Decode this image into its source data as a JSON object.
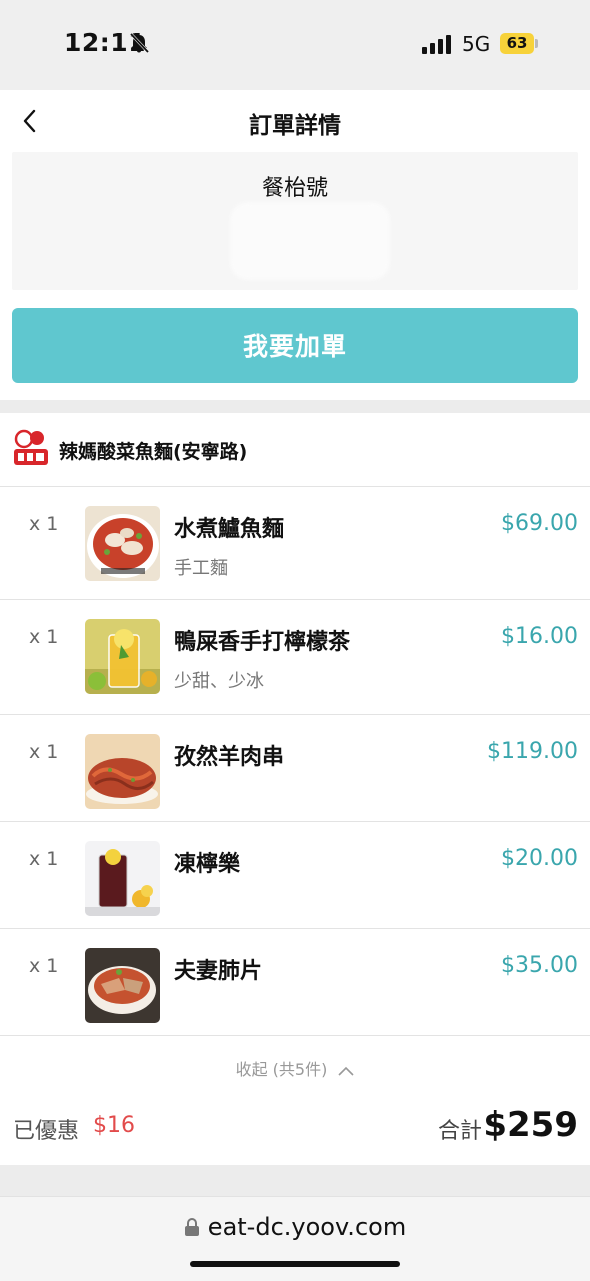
{
  "status_bar": {
    "time": "12:11",
    "network": "5G",
    "battery": "63"
  },
  "header": {
    "title": "訂單詳情",
    "table_label": "餐枱號",
    "add_order_label": "我要加單"
  },
  "restaurant": {
    "name": "辣媽酸菜魚麵(安寧路)"
  },
  "items": [
    {
      "qty": "x 1",
      "name": "水煮鱸魚麵",
      "option": "手工麵",
      "price": "$69.00"
    },
    {
      "qty": "x 1",
      "name": "鴨屎香手打檸檬茶",
      "option": "少甜、少冰",
      "price": "$16.00"
    },
    {
      "qty": "x 1",
      "name": "孜然羊肉串",
      "option": "",
      "price": "$119.00"
    },
    {
      "qty": "x 1",
      "name": "凍檸樂",
      "option": "",
      "price": "$20.00"
    },
    {
      "qty": "x 1",
      "name": "夫妻肺片",
      "option": "",
      "price": "$35.00"
    }
  ],
  "summary": {
    "collapse_label": "收起 (共5件)",
    "discount_label": "已優惠",
    "discount_value": "$16",
    "total_label": "合計",
    "total_value": "$259"
  },
  "browser": {
    "url": "eat-dc.yoov.com"
  },
  "colors": {
    "accent": "#5fc7cf",
    "price": "#3aa6ad",
    "discount": "#e24b4b"
  }
}
